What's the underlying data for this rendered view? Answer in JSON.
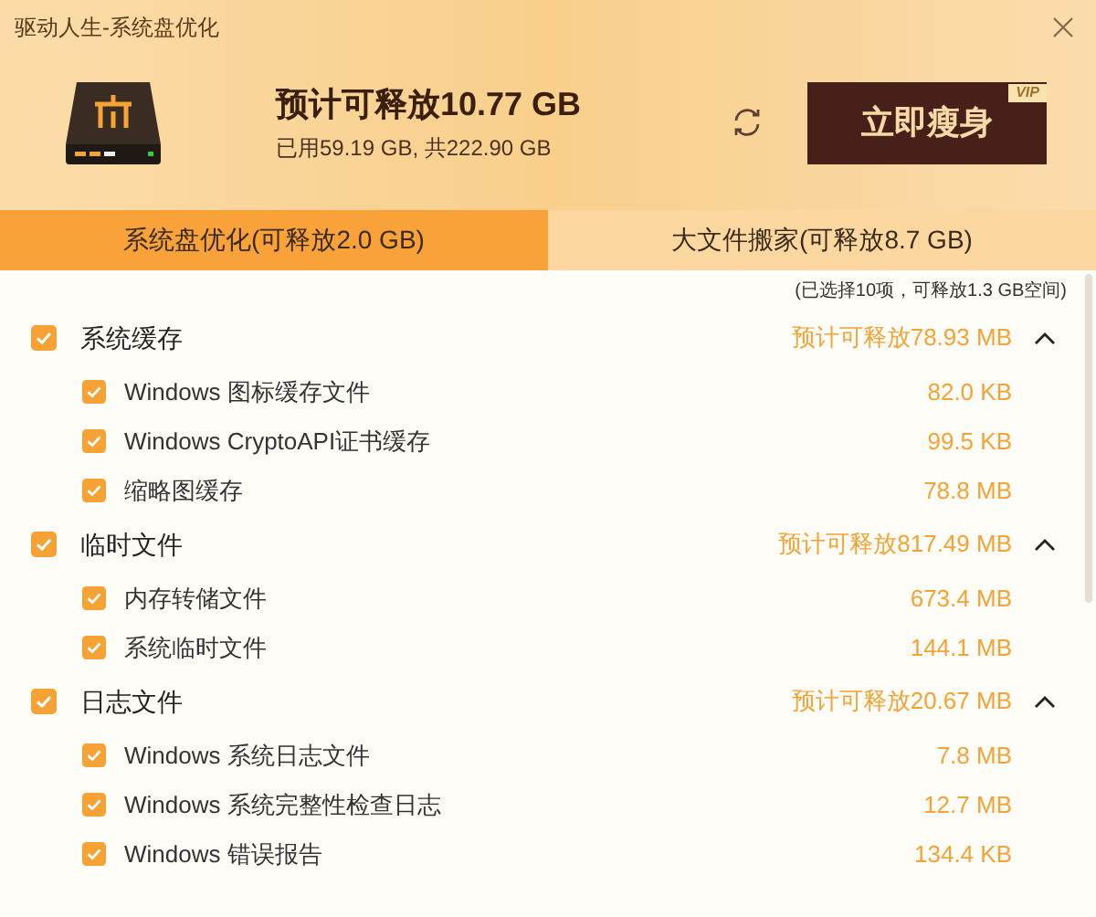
{
  "window": {
    "title": "驱动人生-系统盘优化"
  },
  "header": {
    "headline": "预计可释放10.77 GB",
    "usage": "已用59.19 GB, 共222.90 GB",
    "action_button": "立即瘦身",
    "badge": "VIP"
  },
  "tabs": [
    {
      "label": "系统盘优化(可释放2.0 GB)",
      "selected": true
    },
    {
      "label": "大文件搬家(可释放8.7 GB)",
      "selected": false
    }
  ],
  "selection_summary": "(已选择10项，可释放1.3 GB空间)",
  "groups": [
    {
      "name": "系统缓存",
      "checked": true,
      "expanded": true,
      "estimate": "预计可释放78.93 MB",
      "children": [
        {
          "name": "Windows 图标缓存文件",
          "checked": true,
          "size": "82.0 KB"
        },
        {
          "name": "Windows CryptoAPI证书缓存",
          "checked": true,
          "size": "99.5 KB"
        },
        {
          "name": "缩略图缓存",
          "checked": true,
          "size": "78.8 MB"
        }
      ]
    },
    {
      "name": "临时文件",
      "checked": true,
      "expanded": true,
      "estimate": "预计可释放817.49 MB",
      "children": [
        {
          "name": "内存转储文件",
          "checked": true,
          "size": "673.4 MB"
        },
        {
          "name": "系统临时文件",
          "checked": true,
          "size": "144.1 MB"
        }
      ]
    },
    {
      "name": "日志文件",
      "checked": true,
      "expanded": true,
      "estimate": "预计可释放20.67 MB",
      "children": [
        {
          "name": "Windows 系统日志文件",
          "checked": true,
          "size": "7.8 MB"
        },
        {
          "name": "Windows 系统完整性检查日志",
          "checked": true,
          "size": "12.7 MB"
        },
        {
          "name": "Windows 错误报告",
          "checked": true,
          "size": "134.4 KB"
        }
      ]
    }
  ]
}
